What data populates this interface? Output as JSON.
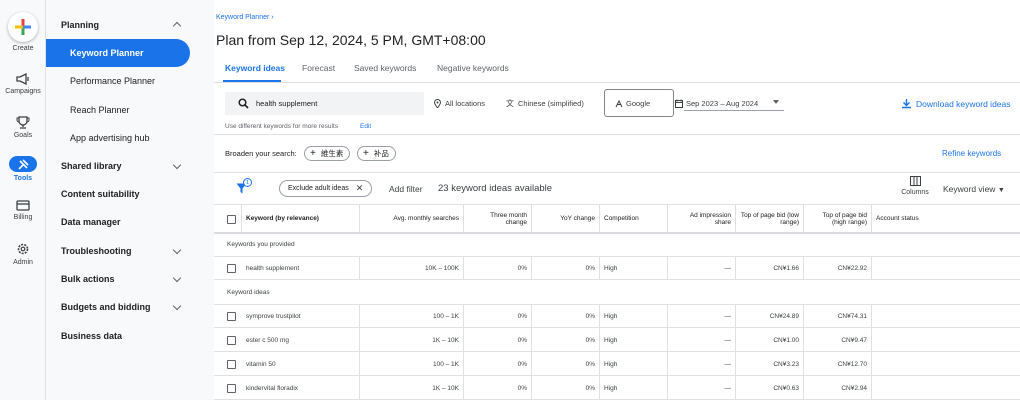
{
  "rail": [
    {
      "label": "Create",
      "icon": "plus-icon"
    },
    {
      "label": "Campaigns",
      "icon": "megaphone-icon"
    },
    {
      "label": "Goals",
      "icon": "trophy-icon"
    },
    {
      "label": "Tools",
      "icon": "tools-icon"
    },
    {
      "label": "Billing",
      "icon": "credit-card-icon"
    },
    {
      "label": "Admin",
      "icon": "gear-icon"
    }
  ],
  "sidebar": {
    "planning": "Planning",
    "keyword_planner": "Keyword Planner",
    "performance_planner": "Performance Planner",
    "reach_planner": "Reach Planner",
    "app_advertising_hub": "App advertising hub",
    "shared_library": "Shared library",
    "content_suitability": "Content suitability",
    "data_manager": "Data manager",
    "troubleshooting": "Troubleshooting",
    "bulk_actions": "Bulk actions",
    "budgets_bidding": "Budgets and bidding",
    "business_data": "Business data"
  },
  "header": {
    "breadcrumb": "Keyword Planner",
    "title": "Plan from Sep 12, 2024, 5 PM, GMT+08:00"
  },
  "tabs": [
    "Keyword ideas",
    "Forecast",
    "Saved keywords",
    "Negative keywords"
  ],
  "search": {
    "query": "health supplement",
    "locations": "All locations",
    "language": "Chinese (simplified)",
    "network": "Google",
    "date_range": "Sep 2023 – Aug 2024",
    "download": "Download keyword ideas",
    "hint": "Use different keywords for more results",
    "hint_link": "Edit"
  },
  "broaden": {
    "label": "Broaden your search:",
    "chips": [
      "維生素",
      "补品"
    ],
    "refine": "Refine keywords"
  },
  "toolbar": {
    "filter_badge": "1",
    "exclude_chip": "Exclude adult ideas",
    "add_filter": "Add filter",
    "count": "23 keyword ideas available",
    "columns": "Columns",
    "keyword_view": "Keyword view"
  },
  "table": {
    "headers": {
      "keyword": "Keyword (by relevance)",
      "searches": "Avg. monthly searches",
      "three_month": "Three month change",
      "yoy": "YoY change",
      "competition": "Competition",
      "impression": "Ad impression share",
      "low_bid": "Top of page bid (low range)",
      "high_bid": "Top of page bid (high range)",
      "status": "Account status"
    },
    "section_provided": "Keywords you provided",
    "section_ideas": "Keyword ideas",
    "provided": [
      {
        "keyword": "health supplement",
        "searches": "10K – 100K",
        "three_month": "0%",
        "yoy": "0%",
        "competition": "High",
        "impression": "—",
        "low": "CN¥1.66",
        "high": "CN¥22.92"
      }
    ],
    "ideas": [
      {
        "keyword": "symprove trustpilot",
        "searches": "100 – 1K",
        "three_month": "0%",
        "yoy": "0%",
        "competition": "High",
        "impression": "—",
        "low": "CN¥24.89",
        "high": "CN¥74.31"
      },
      {
        "keyword": "ester c 500 mg",
        "searches": "1K – 10K",
        "three_month": "0%",
        "yoy": "0%",
        "competition": "High",
        "impression": "—",
        "low": "CN¥1.00",
        "high": "CN¥9.47"
      },
      {
        "keyword": "vitamin 50",
        "searches": "100 – 1K",
        "three_month": "0%",
        "yoy": "0%",
        "competition": "High",
        "impression": "—",
        "low": "CN¥3.23",
        "high": "CN¥12.70"
      },
      {
        "keyword": "kindervital floradix",
        "searches": "1K – 10K",
        "three_month": "0%",
        "yoy": "0%",
        "competition": "High",
        "impression": "—",
        "low": "CN¥0.63",
        "high": "CN¥2.94"
      }
    ]
  }
}
